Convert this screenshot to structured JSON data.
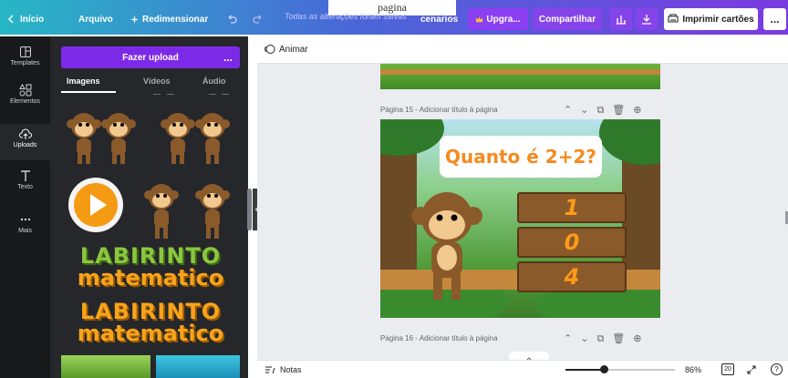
{
  "header": {
    "overlay_text": "pagina",
    "home_label": "Início",
    "file_label": "Arquivo",
    "resize_label": "Redimensionar",
    "saved_status": "Todas as alterações foram salvas",
    "design_name": "cenarios",
    "upgrade_label": "Upgra...",
    "share_label": "Compartilhar",
    "print_label": "Imprimir cartões",
    "more_label": "..."
  },
  "rail": {
    "items": [
      {
        "label": "Templates",
        "icon": "templates-icon"
      },
      {
        "label": "Elementos",
        "icon": "elements-icon"
      },
      {
        "label": "Uploads",
        "icon": "upload-cloud-icon"
      },
      {
        "label": "Texto",
        "icon": "text-icon"
      },
      {
        "label": "Mais",
        "icon": "more-dots-icon"
      }
    ]
  },
  "panel": {
    "upload_label": "Fazer upload",
    "upload_more": "...",
    "tabs": [
      "Imagens",
      "Vídeos",
      "Áudio"
    ],
    "wordart_1": [
      "LABIRINTO",
      "matematico"
    ],
    "wordart_2": [
      "LABIRINTO",
      "matematico"
    ]
  },
  "editor": {
    "animate_label": "Animar",
    "page15_label": "Página 15 - Adicionar título à página",
    "page16_label": "Página 16 - Adicionar título à página",
    "slide_question": "Quanto é 2+2?",
    "answers": [
      "1",
      "0",
      "4"
    ]
  },
  "footer": {
    "notes_label": "Notas",
    "zoom": "86%",
    "page_count": "20",
    "help": "?",
    "zoom_fraction": 0.35
  },
  "colors": {
    "canva_purple": "#7d2ae8",
    "toolbar_start": "#27b7c5",
    "toolbar_end": "#7b3ae0",
    "question_orange": "#f58a1f",
    "answer_orange": "#ff9a1a"
  }
}
